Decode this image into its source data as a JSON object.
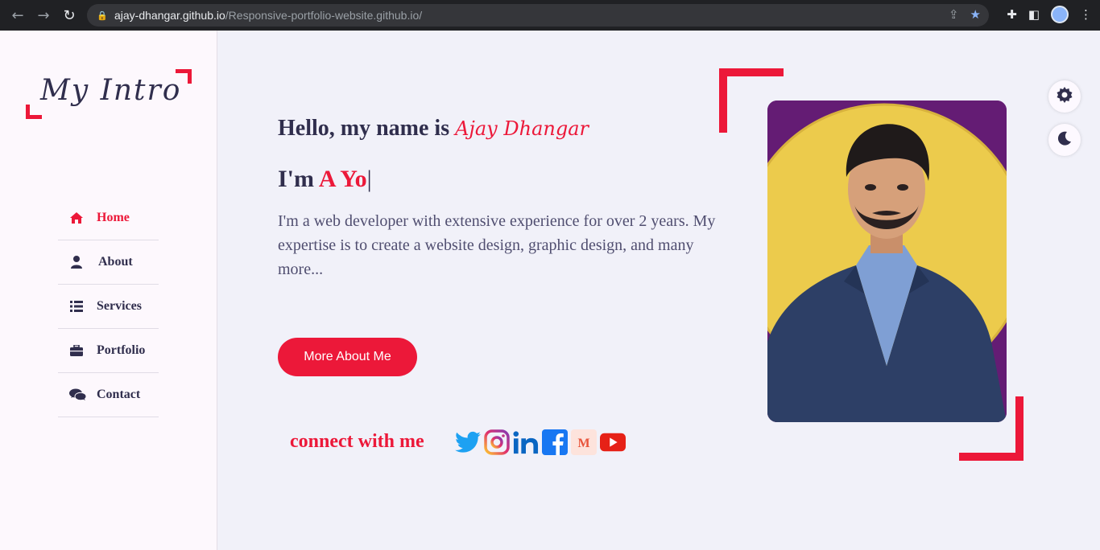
{
  "browser": {
    "url_host": "ajay-dhangar.github.io",
    "url_path": "/Responsive-portfolio-website.github.io/"
  },
  "sidebar": {
    "logo": "My Intro",
    "items": [
      {
        "label": "Home",
        "icon": "home-icon",
        "active": true
      },
      {
        "label": "About",
        "icon": "user-icon",
        "active": false
      },
      {
        "label": "Services",
        "icon": "list-icon",
        "active": false
      },
      {
        "label": "Portfolio",
        "icon": "briefcase-icon",
        "active": false
      },
      {
        "label": "Contact",
        "icon": "comments-icon",
        "active": false
      }
    ]
  },
  "hero": {
    "greeting": "Hello, my name is ",
    "name": "Ajay Dhangar",
    "iam_prefix": "I'm ",
    "typed": "A Yo",
    "cursor": "|",
    "description": "I'm a web developer with extensive experience for over 2 years. My expertise is to create a website design, graphic design, and many more...",
    "button": "More About Me",
    "connect": "connect with me",
    "socials": [
      "twitter-icon",
      "instagram-icon",
      "linkedin-icon",
      "facebook-icon",
      "medium-icon",
      "youtube-icon"
    ]
  },
  "colors": {
    "accent": "#ec1839",
    "text": "#302e4d",
    "photo_bg": "#641c74",
    "photo_circle": "#eccb4c"
  }
}
